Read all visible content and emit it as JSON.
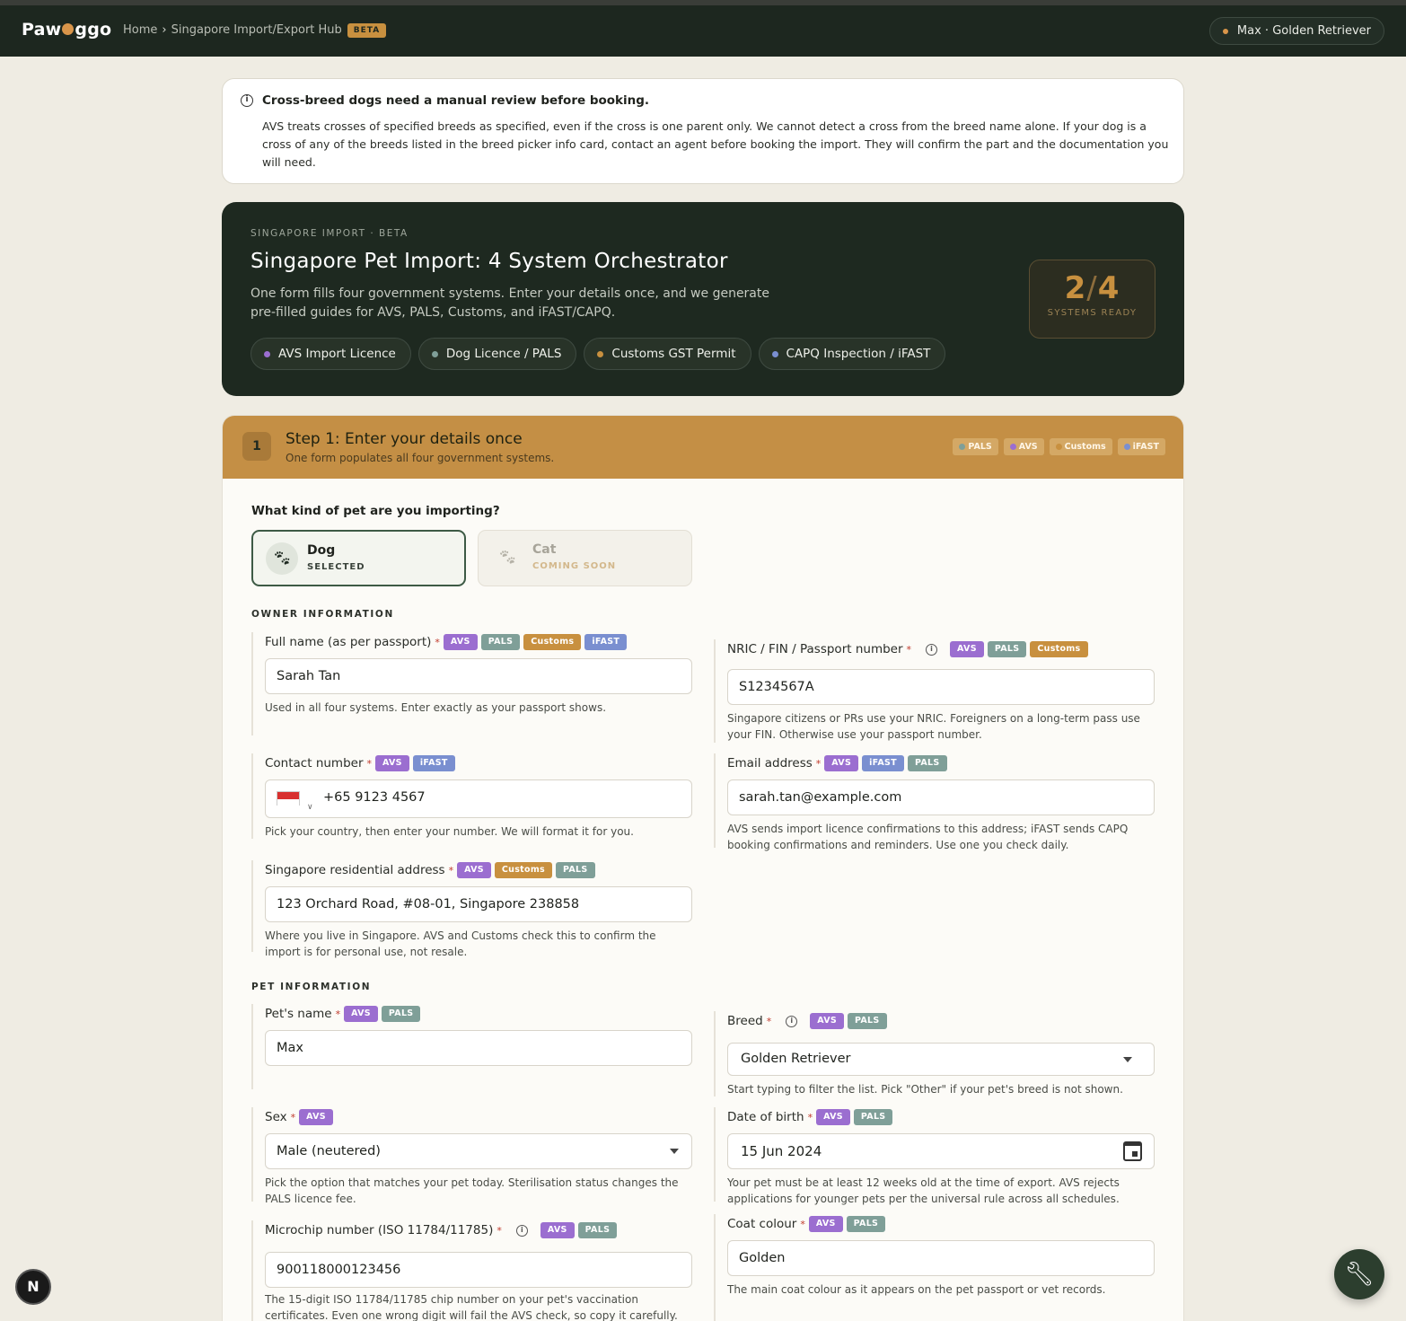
{
  "topbar": {
    "logo_left": "Paw",
    "logo_right": "ggo",
    "breadcrumb_home": "Home",
    "breadcrumb_sep": "›",
    "breadcrumb_current": "Singapore Import/Export Hub",
    "beta": "BETA",
    "pet_pill": "Max · Golden Retriever"
  },
  "notice": {
    "title": "Cross-breed dogs need a manual review before booking.",
    "body": "AVS treats crosses of specified breeds as specified, even if the cross is one parent only. We cannot detect a cross from the breed name alone. If your dog is a cross of any of the breeds listed in the breed picker info card, contact an agent before booking the import. They will confirm the part and the documentation you will need."
  },
  "hero": {
    "eyebrow": "SINGAPORE IMPORT · BETA",
    "title": "Singapore Pet Import: 4 System Orchestrator",
    "subtitle": "One form fills four government systems. Enter your details once, and we generate pre-filled guides for AVS, PALS, Customs, and iFAST/CAPQ.",
    "chips": [
      {
        "label": "AVS Import Licence",
        "color": "#9b6ed0"
      },
      {
        "label": "Dog Licence / PALS",
        "color": "#7f9f98"
      },
      {
        "label": "Customs GST Permit",
        "color": "#c8903f"
      },
      {
        "label": "CAPQ Inspection / iFAST",
        "color": "#7a8fd0"
      }
    ],
    "ready_count": "2",
    "ready_slash": "/",
    "ready_total": "4",
    "ready_label": "SYSTEMS READY"
  },
  "step": {
    "number": "1",
    "title": "Step 1: Enter your details once",
    "subtitle": "One form populates all four government systems.",
    "badges": [
      {
        "label": "PALS",
        "color": "#7f9f98"
      },
      {
        "label": "AVS",
        "color": "#9b6ed0"
      },
      {
        "label": "Customs",
        "color": "#c8903f"
      },
      {
        "label": "iFAST",
        "color": "#7a8fd0"
      }
    ]
  },
  "pet_type": {
    "question": "What kind of pet are you importing?",
    "dog_name": "Dog",
    "dog_status": "SELECTED",
    "cat_name": "Cat",
    "cat_status": "COMING SOON"
  },
  "owner": {
    "heading": "OWNER INFORMATION",
    "fullname_label": "Full name (as per passport)",
    "fullname_value": "Sarah Tan",
    "fullname_help": "Used in all four systems. Enter exactly as your passport shows.",
    "nric_label": "NRIC / FIN / Passport number",
    "nric_value": "S1234567A",
    "nric_help": "Singapore citizens or PRs use your NRIC. Foreigners on a long-term pass use your FIN. Otherwise use your passport number.",
    "contact_label": "Contact number",
    "contact_value": "+65 9123 4567",
    "contact_help": "Pick your country, then enter your number. We will format it for you.",
    "email_label": "Email address",
    "email_value": "sarah.tan@example.com",
    "email_help": "AVS sends import licence confirmations to this address; iFAST sends CAPQ booking confirmations and reminders. Use one you check daily.",
    "address_label": "Singapore residential address",
    "address_value": "123 Orchard Road, #08-01, Singapore 238858",
    "address_help": "Where you live in Singapore. AVS and Customs check this to confirm the import is for personal use, not resale."
  },
  "pet": {
    "heading": "PET INFORMATION",
    "name_label": "Pet's name",
    "name_value": "Max",
    "breed_label": "Breed",
    "breed_value": "Golden Retriever",
    "breed_help": "Start typing to filter the list. Pick \"Other\" if your pet's breed is not shown.",
    "sex_label": "Sex",
    "sex_value": "Male (neutered)",
    "sex_help": "Pick the option that matches your pet today. Sterilisation status changes the PALS licence fee.",
    "dob_label": "Date of birth",
    "dob_value": "15 Jun 2024",
    "dob_help": "Your pet must be at least 12 weeks old at the time of export. AVS rejects applications for younger pets per the universal rule across all schedules.",
    "chip_label": "Microchip number (ISO 11784/11785)",
    "chip_value": "900118000123456",
    "chip_help": "The 15-digit ISO 11784/11785 chip number on your pet's vaccination certificates. Even one wrong digit will fail the AVS check, so copy it carefully.",
    "coat_label": "Coat colour",
    "coat_value": "Golden",
    "coat_help": "The main coat colour as it appears on the pet passport or vet records."
  },
  "tags": {
    "avs": "AVS",
    "pals": "PALS",
    "customs": "Customs",
    "ifast": "iFAST",
    "required": "*"
  },
  "misc": {
    "dev_button": "N"
  }
}
